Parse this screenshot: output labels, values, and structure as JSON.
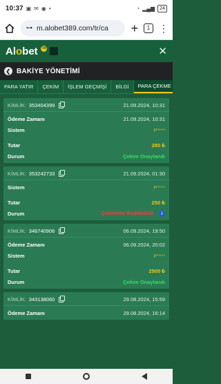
{
  "status_bar": {
    "time": "10:37",
    "battery": "24"
  },
  "browser": {
    "url": "m.alobet389.com/tr/ca",
    "tab_count": "1"
  },
  "header": {
    "logo_main": "Al",
    "logo_accent": "o",
    "logo_tail": "bet",
    "logo_badge": "TM"
  },
  "page": {
    "title": "BAKİYE YÖNETİMİ"
  },
  "tabs": [
    {
      "label": "PARA YATIR"
    },
    {
      "label": "ÇEKİM"
    },
    {
      "label": "İŞLEM GEÇMİŞİ"
    },
    {
      "label": "BİLGİ"
    },
    {
      "label": "PARA ÇEKME DU"
    }
  ],
  "labels": {
    "kimlik": "KİMLİK:",
    "odeme_zamani": "Ödeme Zamanı",
    "sistem": "Sistem",
    "tutar": "Tutar",
    "durum": "Durum"
  },
  "cards": [
    {
      "id": "353404399",
      "date": "21.09.2024, 10:31",
      "payment_time": "21.09.2024, 10:31",
      "system": "P****",
      "amount": "280 ₺",
      "status": "Çekim Onaylandı"
    },
    {
      "id": "353242733",
      "date": "21.09.2024, 01:30",
      "system": "P****",
      "amount": "250 ₺",
      "status": "Çekiminiz Reddedildi"
    },
    {
      "id": "346740906",
      "date": "06.09.2024, 19:50",
      "payment_time": "06.09.2024, 20:02",
      "system": "P****",
      "amount": "2500 ₺",
      "status": "Çekim Onaylandı"
    },
    {
      "id": "343138060",
      "date": "29.08.2024, 15:59",
      "payment_time": "29.08.2024, 16:14"
    }
  ],
  "colors": {
    "brand_green": "#17603c",
    "card_green": "#2a7b53",
    "accent_gold": "#f3c613",
    "approved": "#2fe067",
    "rejected": "#ff3b3b"
  }
}
